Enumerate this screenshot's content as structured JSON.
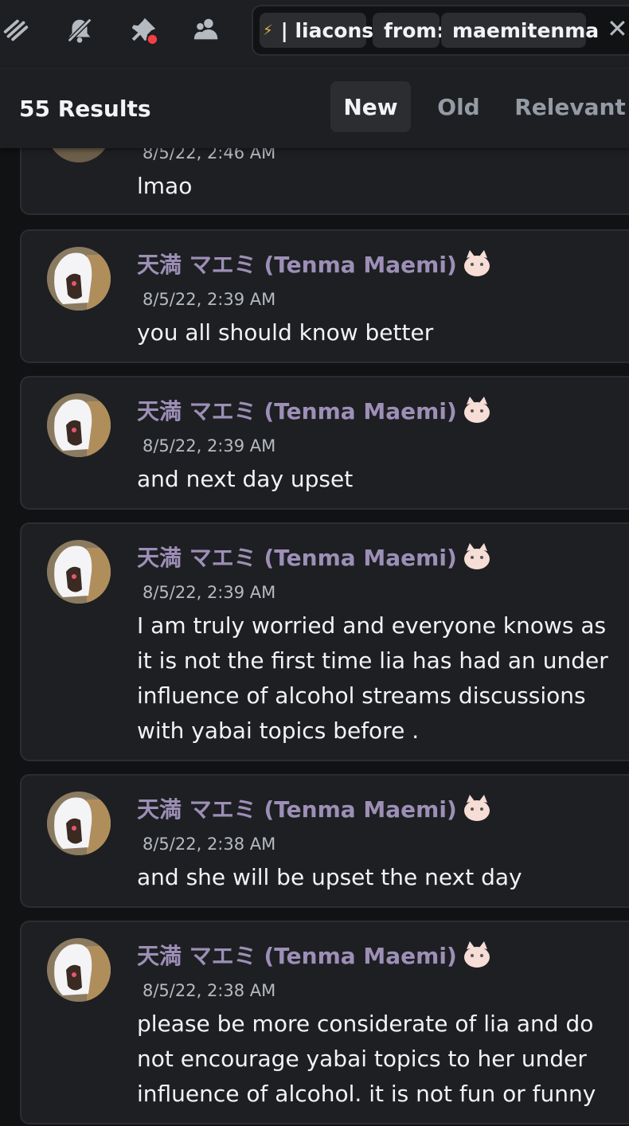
{
  "toolbar": {
    "icons": [
      "threads-icon",
      "mute-bell-icon",
      "pin-icon",
      "members-icon"
    ],
    "search": {
      "chip_channel": "| liacons",
      "chip_from_label": "from:",
      "chip_from_value": "maemitenma",
      "close_glyph": "✕"
    }
  },
  "results": {
    "count_label": "55 Results",
    "sort_tabs": [
      "New",
      "Old",
      "Relevant"
    ],
    "active_sort": "New"
  },
  "messages": [
    {
      "author": "",
      "timestamp": "8/5/22, 2:46 AM",
      "lines": [
        "lmao"
      ]
    },
    {
      "author": "天満 マエミ (Tenma Maemi)",
      "timestamp": "8/5/22, 2:39 AM",
      "lines": [
        "you all should know better"
      ]
    },
    {
      "author": "天満 マエミ (Tenma Maemi)",
      "timestamp": "8/5/22, 2:39 AM",
      "lines": [
        "and next day upset"
      ]
    },
    {
      "author": "天満 マエミ (Tenma Maemi)",
      "timestamp": "8/5/22, 2:39 AM",
      "lines": [
        "I am truly worried and everyone knows as",
        "it is not the first time lia has had an under",
        "influence of alcohol streams discussions",
        "with yabai topics before ."
      ]
    },
    {
      "author": "天満 マエミ (Tenma Maemi)",
      "timestamp": "8/5/22, 2:38 AM",
      "lines": [
        "and she will be upset the next day"
      ]
    },
    {
      "author": "天満 マエミ (Tenma Maemi)",
      "timestamp": "8/5/22, 2:38 AM",
      "lines": [
        "please be more considerate of lia and do",
        "not encourage yabai topics to her under",
        "influence of alcohol. it is not fun or funny"
      ]
    }
  ],
  "colors": {
    "background": "#111214",
    "panel": "#1e1f22",
    "author_name": "#9d8fb7",
    "active_tab_bg": "#2b2d31"
  }
}
